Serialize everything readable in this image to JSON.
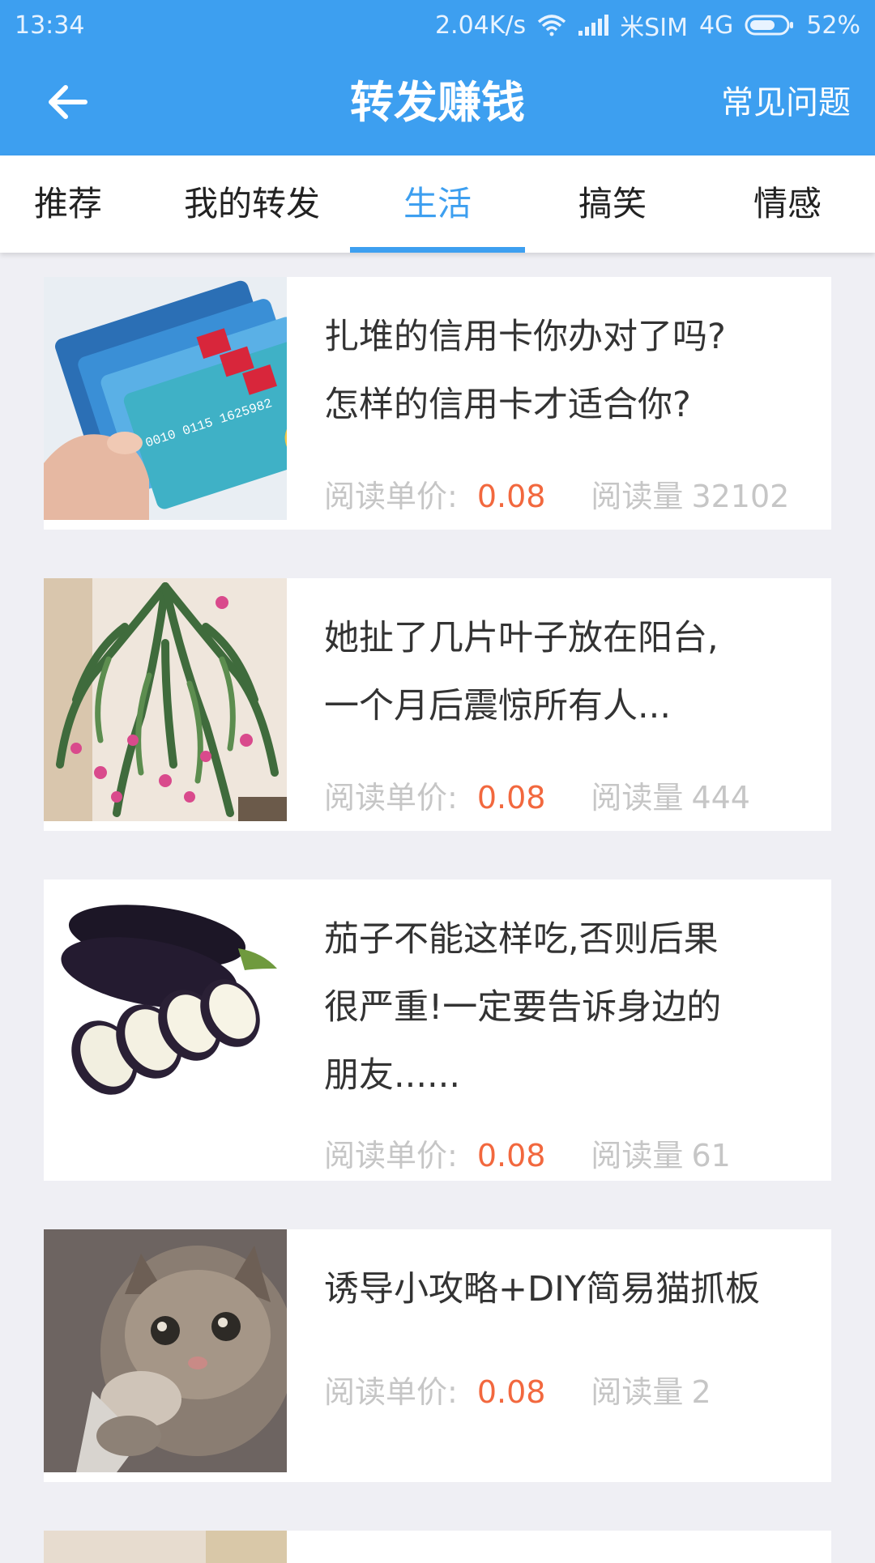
{
  "status_bar": {
    "time": "13:34",
    "speed": "2.04K/s",
    "carrier": "米SIM",
    "network": "4G",
    "battery": "52%"
  },
  "appbar": {
    "title": "转发赚钱",
    "faq": "常见问题",
    "back_icon": "arrow-left-icon"
  },
  "tabs": [
    {
      "label": "推荐",
      "active": false
    },
    {
      "label": "我的转发",
      "active": false
    },
    {
      "label": "生活",
      "active": true
    },
    {
      "label": "搞笑",
      "active": false
    },
    {
      "label": "情感",
      "active": false
    }
  ],
  "articles": [
    {
      "title_line1": "扎堆的信用卡你办对了吗?",
      "title_line2": "怎样的信用卡才适合你?",
      "title_line3": "",
      "price_label": "阅读单价:",
      "price": "0.08",
      "views_label": "阅读量",
      "views": "32102",
      "thumb": "credit-cards-image"
    },
    {
      "title_line1": "她扯了几片叶子放在阳台,",
      "title_line2": "一个月后震惊所有人...",
      "title_line3": "",
      "price_label": "阅读单价:",
      "price": "0.08",
      "views_label": "阅读量",
      "views": "444",
      "thumb": "cactus-plant-image"
    },
    {
      "title_line1": "茄子不能这样吃,否则后果",
      "title_line2": "很严重!一定要告诉身边的",
      "title_line3": "朋友......",
      "price_label": "阅读单价:",
      "price": "0.08",
      "views_label": "阅读量",
      "views": "61",
      "thumb": "eggplant-image"
    },
    {
      "title_line1": "诱导小攻略+DIY简易猫抓板",
      "title_line2": "",
      "title_line3": "",
      "price_label": "阅读单价:",
      "price": "0.08",
      "views_label": "阅读量",
      "views": "2",
      "thumb": "cat-image"
    }
  ]
}
